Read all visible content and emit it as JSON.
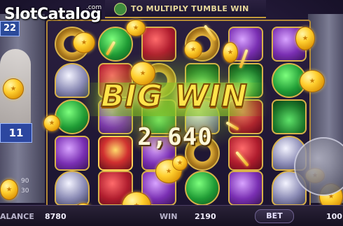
{
  "watermark": {
    "brand": "SlotCatalog",
    "suffix": ".com"
  },
  "banner": {
    "text": "TO MULTIPLY TUMBLE WIN"
  },
  "side": {
    "badge_top": "22",
    "badge_mid": "11",
    "small_a": "90",
    "small_b": "30"
  },
  "bigwin": {
    "title": "BIG WIN",
    "amount": "2,640"
  },
  "footer": {
    "balance_label": "ALANCE",
    "balance_value": "8780",
    "win_label": "WIN",
    "win_value": "2190",
    "bet_label": "BET",
    "bet_value": "100"
  },
  "colors": {
    "accent": "#ffe44a",
    "frame": "#b48a36",
    "glow": "#c8ff4a"
  }
}
